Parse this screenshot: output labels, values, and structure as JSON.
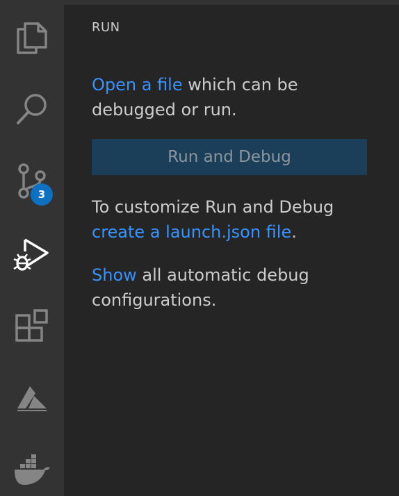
{
  "activity_bar": {
    "items": [
      {
        "name": "explorer",
        "icon": "files-icon"
      },
      {
        "name": "search",
        "icon": "search-icon"
      },
      {
        "name": "source-control",
        "icon": "source-control-icon",
        "badge": "3"
      },
      {
        "name": "run-debug",
        "icon": "run-debug-icon",
        "active": true
      },
      {
        "name": "extensions",
        "icon": "extensions-icon"
      },
      {
        "name": "azure",
        "icon": "azure-icon"
      },
      {
        "name": "docker",
        "icon": "docker-icon"
      }
    ],
    "badge_color": "#0e70c0"
  },
  "sidebar": {
    "title": "RUN",
    "open_file": {
      "link": "Open a file",
      "text": " which can be debugged or run."
    },
    "run_button": "Run and Debug",
    "customize": {
      "text": "To customize Run and Debug",
      "link": "create a launch.json file",
      "suffix": "."
    },
    "show": {
      "link": "Show",
      "text": " all automatic debug configurations."
    }
  },
  "colors": {
    "link": "#3794ff",
    "button_bg": "#1b3f59",
    "sidebar_bg": "#252526",
    "activity_bg": "#333333"
  }
}
